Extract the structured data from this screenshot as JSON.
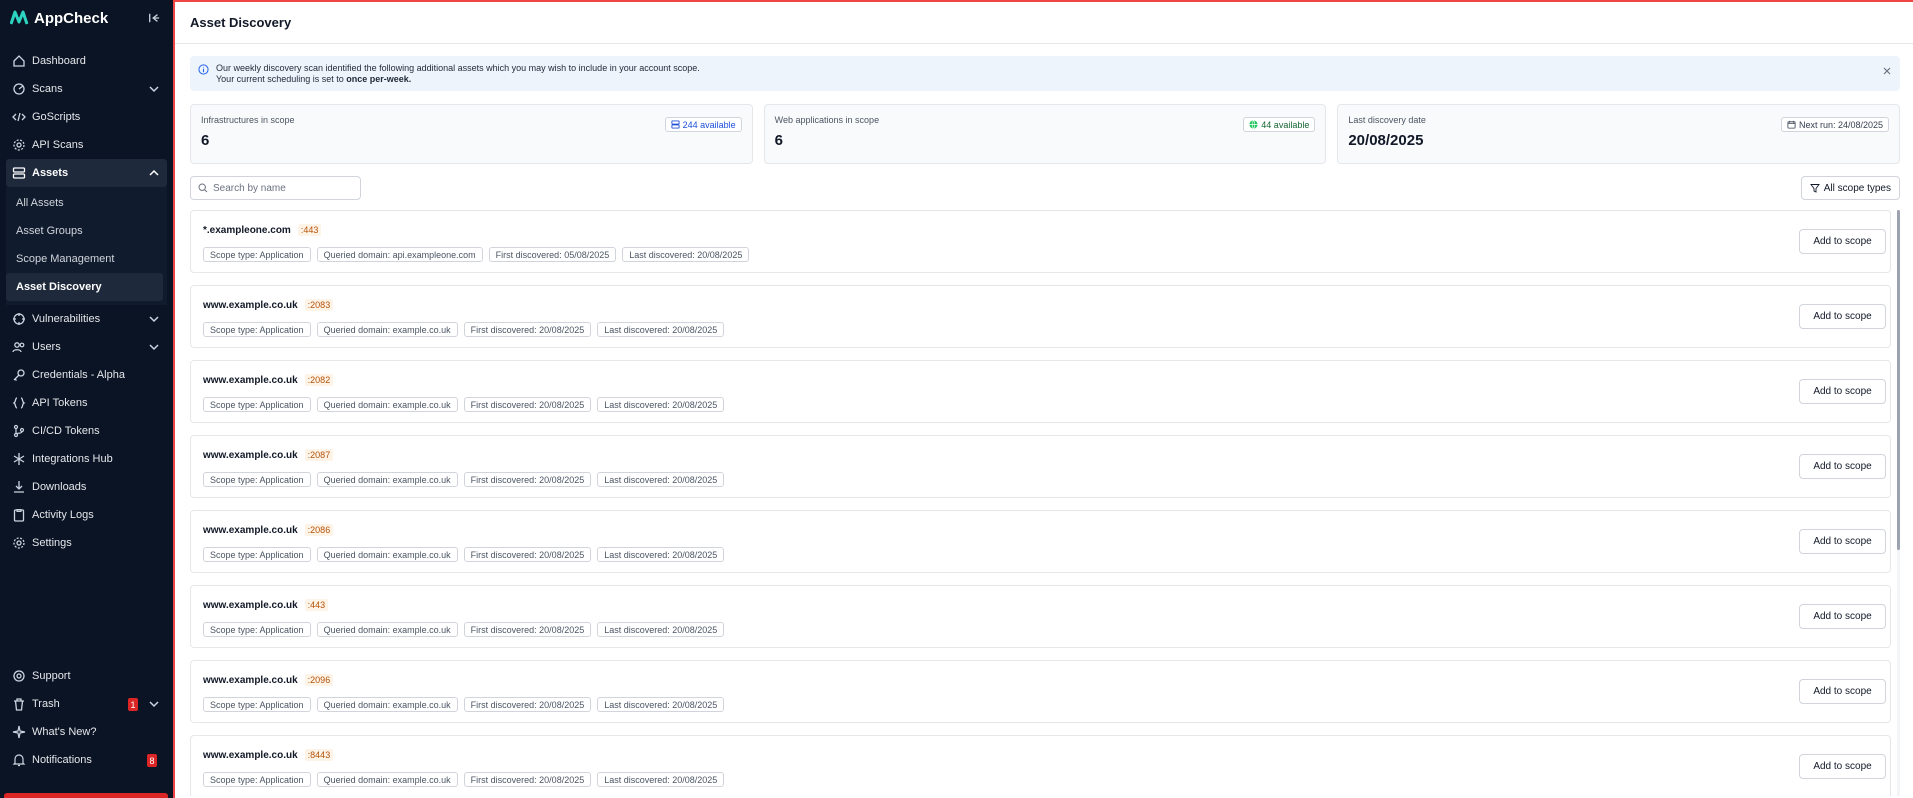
{
  "app": {
    "name": "AppCheck"
  },
  "sidebar": {
    "items": [
      {
        "label": "Dashboard",
        "icon": "home-icon"
      },
      {
        "label": "Scans",
        "icon": "radar-icon",
        "expand": true
      },
      {
        "label": "GoScripts",
        "icon": "code-icon"
      },
      {
        "label": "API Scans",
        "icon": "gear-icon"
      },
      {
        "label": "Assets",
        "icon": "server-icon",
        "active": true
      }
    ],
    "assets_sub": [
      "All Assets",
      "Asset Groups",
      "Scope Management",
      "Asset Discovery"
    ],
    "items_after": [
      {
        "label": "Vulnerabilities",
        "icon": "target-icon",
        "expand": true
      },
      {
        "label": "Users",
        "icon": "users-icon",
        "expand": true
      },
      {
        "label": "Credentials - Alpha",
        "icon": "key-icon"
      },
      {
        "label": "API Tokens",
        "icon": "braces-icon"
      },
      {
        "label": "CI/CD Tokens",
        "icon": "git-branch-icon"
      },
      {
        "label": "Integrations Hub",
        "icon": "snowflake-icon"
      },
      {
        "label": "Downloads",
        "icon": "download-icon"
      },
      {
        "label": "Activity Logs",
        "icon": "clipboard-icon"
      },
      {
        "label": "Settings",
        "icon": "cog-icon"
      }
    ],
    "bottom": [
      {
        "label": "Support",
        "icon": "support-icon"
      },
      {
        "label": "Trash",
        "icon": "trash-icon",
        "badge": "1"
      },
      {
        "label": "What's New?",
        "icon": "sparkle-icon"
      },
      {
        "label": "Notifications",
        "icon": "bell-icon",
        "badge": "8"
      }
    ]
  },
  "page": {
    "title": "Asset Discovery",
    "banner": {
      "line1": "Our weekly discovery scan identified the following additional assets which you may wish to include in your account scope.",
      "line2_prefix": "Your current scheduling is set to ",
      "line2_bold": "once per-week."
    },
    "stats": [
      {
        "label": "Infrastructures in scope",
        "value": "6",
        "pill": "244 available"
      },
      {
        "label": "Web applications in scope",
        "value": "6",
        "pill": "44 available"
      },
      {
        "label": "Last discovery date",
        "value": "20/08/2025",
        "pill": "Next run: 24/08/2025"
      }
    ],
    "search_placeholder": "Search by name",
    "filter_label": "All scope types",
    "add_label": "Add to scope",
    "rows": [
      {
        "host": "*.exampleone.com",
        "port": ":443",
        "scope": "Scope type: Application",
        "queried": "Queried domain: api.exampleone.com",
        "first": "First discovered: 05/08/2025",
        "last": "Last discovered: 20/08/2025"
      },
      {
        "host": "www.example.co.uk",
        "port": ":2083",
        "scope": "Scope type: Application",
        "queried": "Queried domain: example.co.uk",
        "first": "First discovered: 20/08/2025",
        "last": "Last discovered: 20/08/2025"
      },
      {
        "host": "www.example.co.uk",
        "port": ":2082",
        "scope": "Scope type: Application",
        "queried": "Queried domain: example.co.uk",
        "first": "First discovered: 20/08/2025",
        "last": "Last discovered: 20/08/2025"
      },
      {
        "host": "www.example.co.uk",
        "port": ":2087",
        "scope": "Scope type: Application",
        "queried": "Queried domain: example.co.uk",
        "first": "First discovered: 20/08/2025",
        "last": "Last discovered: 20/08/2025"
      },
      {
        "host": "www.example.co.uk",
        "port": ":2086",
        "scope": "Scope type: Application",
        "queried": "Queried domain: example.co.uk",
        "first": "First discovered: 20/08/2025",
        "last": "Last discovered: 20/08/2025"
      },
      {
        "host": "www.example.co.uk",
        "port": ":443",
        "scope": "Scope type: Application",
        "queried": "Queried domain: example.co.uk",
        "first": "First discovered: 20/08/2025",
        "last": "Last discovered: 20/08/2025"
      },
      {
        "host": "www.example.co.uk",
        "port": ":2096",
        "scope": "Scope type: Application",
        "queried": "Queried domain: example.co.uk",
        "first": "First discovered: 20/08/2025",
        "last": "Last discovered: 20/08/2025"
      },
      {
        "host": "www.example.co.uk",
        "port": ":8443",
        "scope": "Scope type: Application",
        "queried": "Queried domain: example.co.uk",
        "first": "First discovered: 20/08/2025",
        "last": "Last discovered: 20/08/2025"
      }
    ]
  }
}
